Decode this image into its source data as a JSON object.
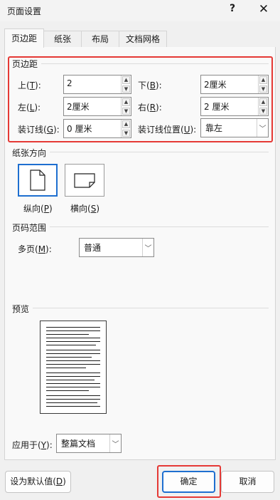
{
  "window": {
    "title": "页面设置",
    "help_label": "?",
    "close_label": "✕"
  },
  "tabs": [
    {
      "label": "页边距",
      "active": true
    },
    {
      "label": "纸张",
      "active": false
    },
    {
      "label": "布局",
      "active": false
    },
    {
      "label": "文档网格",
      "active": false
    }
  ],
  "margins": {
    "title": "页边距",
    "top": {
      "label": "上(",
      "key": "T",
      "suffix": "):",
      "value": "2"
    },
    "bottom": {
      "label": "下(",
      "key": "B",
      "suffix": "):",
      "value": "2厘米"
    },
    "left": {
      "label": "左(",
      "key": "L",
      "suffix": "):",
      "value": "2厘米"
    },
    "right": {
      "label": "右(",
      "key": "R",
      "suffix": "):",
      "value": "2 厘米"
    },
    "gutter": {
      "label": "装订线(",
      "key": "G",
      "suffix": "):",
      "value": "0 厘米"
    },
    "gutter_pos": {
      "label": "装订线位置(",
      "key": "U",
      "suffix": "):",
      "value": "靠左"
    }
  },
  "orientation": {
    "title": "纸张方向",
    "portrait": {
      "label": "纵向(",
      "key": "P",
      "suffix": ")",
      "selected": true
    },
    "landscape": {
      "label": "横向(",
      "key": "S",
      "suffix": ")",
      "selected": false
    }
  },
  "pages": {
    "title": "页码范围",
    "multiple": {
      "label": "多页(",
      "key": "M",
      "suffix": "):",
      "value": "普通"
    }
  },
  "preview": {
    "title": "预览",
    "apply_to": {
      "label": "应用于(",
      "key": "Y",
      "suffix": "):",
      "value": "整篇文档"
    }
  },
  "footer": {
    "default": {
      "label": "设为默认值(",
      "key": "D",
      "suffix": ")"
    },
    "ok_label": "确定",
    "cancel_label": "取消"
  },
  "colors": {
    "accent": "#1e6fd0",
    "highlight": "#e53935"
  },
  "icons": {
    "spin_up": "triangle-up",
    "spin_down": "triangle-down",
    "dropdown": "chevron-down"
  }
}
